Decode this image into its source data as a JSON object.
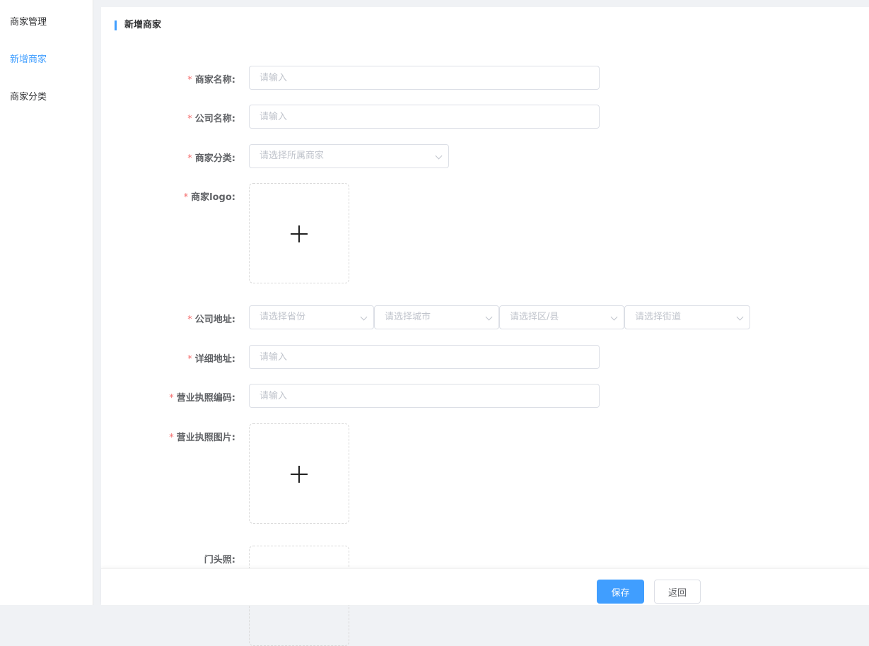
{
  "sidebar": {
    "items": [
      {
        "label": "商家管理"
      },
      {
        "label": "新增商家",
        "active": true
      },
      {
        "label": "商家分类"
      }
    ]
  },
  "page": {
    "title": "新增商家"
  },
  "form": {
    "required_mark": "*",
    "name": {
      "label": "商家名称:",
      "placeholder": "请输入"
    },
    "company": {
      "label": "公司名称:",
      "placeholder": "请输入"
    },
    "category": {
      "label": "商家分类:",
      "placeholder": "请选择所属商家"
    },
    "logo": {
      "label": "商家logo:"
    },
    "address": {
      "label": "公司地址:",
      "province": "请选择省份",
      "city": "请选择城市",
      "district": "请选择区/县",
      "street": "请选择街道"
    },
    "detail": {
      "label": "详细地址:",
      "placeholder": "请输入"
    },
    "license_code": {
      "label": "营业执照编码:",
      "placeholder": "请输入"
    },
    "license_image": {
      "label": "营业执照图片:"
    },
    "storefront": {
      "label": "门头照:"
    }
  },
  "footer": {
    "save": "保存",
    "back": "返回"
  },
  "colors": {
    "accent": "#409eff",
    "required": "#f56c6c"
  }
}
